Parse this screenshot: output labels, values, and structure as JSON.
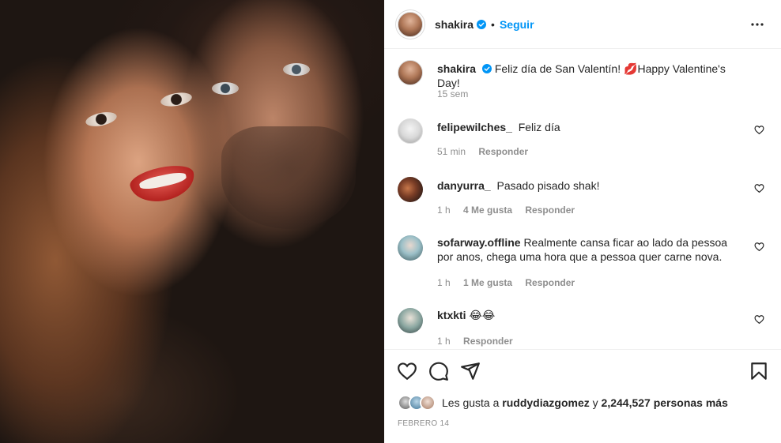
{
  "post": {
    "author": "shakira",
    "follow_label": "Seguir",
    "separator": "•"
  },
  "caption": {
    "username": "shakira",
    "text_before": "Feliz día de San Valentín!",
    "emoji": "💋",
    "text_after": "Happy Valentine's Day!",
    "time": "15 sem"
  },
  "comments": [
    {
      "username": "felipewilches_",
      "text": "Feliz día",
      "time": "51 min",
      "likes": "",
      "reply": "Responder"
    },
    {
      "username": "danyurra_",
      "text": "Pasado pisado shak!",
      "time": "1 h",
      "likes": "4 Me gusta",
      "reply": "Responder"
    },
    {
      "username": "sofarway.offline",
      "text": "Realmente cansa ficar ao lado da pessoa por anos, chega uma hora que a pessoa quer carne nova.",
      "time": "1 h",
      "likes": "1 Me gusta",
      "reply": "Responder"
    },
    {
      "username": "ktxkti",
      "text": "😂😂",
      "time": "1 h",
      "likes": "",
      "reply": "Responder"
    }
  ],
  "likes": {
    "prefix": "Les gusta a",
    "user": "ruddydiazgomez",
    "connector": "y",
    "count": "2,244,527 personas más"
  },
  "date": "FEBRERO 14",
  "colors": {
    "accent": "#0095f6",
    "verified": "#0095f6",
    "text": "#262626",
    "muted": "#8e8e8e",
    "divider": "#efefef"
  },
  "icons": [
    "more-icon",
    "verified-icon",
    "heart-icon",
    "comment-icon",
    "share-icon",
    "bookmark-icon"
  ]
}
